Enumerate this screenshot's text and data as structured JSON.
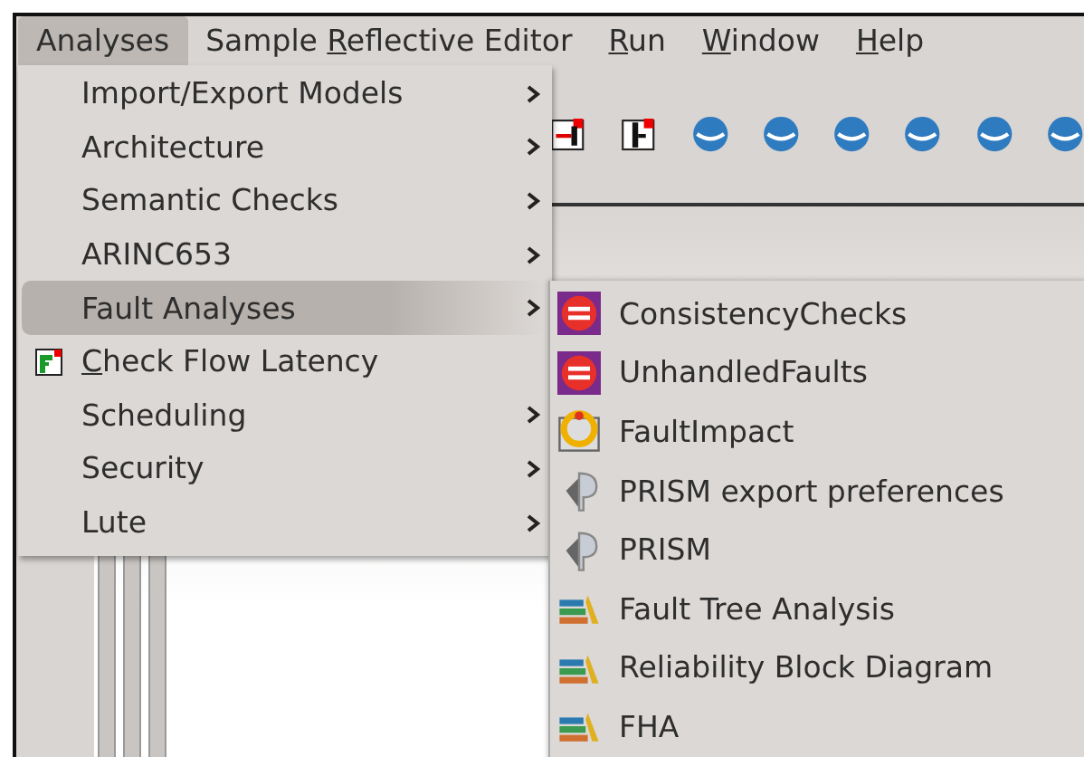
{
  "menubar": [
    {
      "before": "Analyses",
      "selected": true
    },
    {
      "before": "Sample ",
      "mnemonic": "R",
      "after": "eflective Editor",
      "selected": false
    },
    {
      "mnemonic": "R",
      "after": "un",
      "selected": false
    },
    {
      "mnemonic": "W",
      "after": "indow",
      "selected": false
    },
    {
      "mnemonic": "H",
      "after": "elp",
      "selected": false
    }
  ],
  "analyses_menu": [
    {
      "before": "Import/Export Models",
      "has_submenu": true,
      "selected": false
    },
    {
      "before": "Architecture",
      "has_submenu": true,
      "selected": false
    },
    {
      "before": "Semantic Checks",
      "has_submenu": true,
      "selected": false
    },
    {
      "before": "ARINC653",
      "has_submenu": true,
      "selected": false
    },
    {
      "before": "Fault Analyses",
      "has_submenu": true,
      "selected": true
    },
    {
      "mnemonic": "C",
      "after": "heck Flow Latency",
      "has_submenu": false,
      "selected": false
    },
    {
      "before": "Scheduling",
      "has_submenu": true,
      "selected": false
    },
    {
      "before": "Security",
      "has_submenu": true,
      "selected": false
    },
    {
      "before": "Lute",
      "has_submenu": true,
      "selected": false
    }
  ],
  "fault_analyses_menu": [
    {
      "label": "ConsistencyChecks"
    },
    {
      "label": "UnhandledFaults"
    },
    {
      "label": "FaultImpact"
    },
    {
      "label": "PRISM export preferences"
    },
    {
      "label": "PRISM"
    },
    {
      "label": "Fault Tree Analysis"
    },
    {
      "label": "Reliability Block Diagram"
    },
    {
      "label": "FHA"
    }
  ]
}
